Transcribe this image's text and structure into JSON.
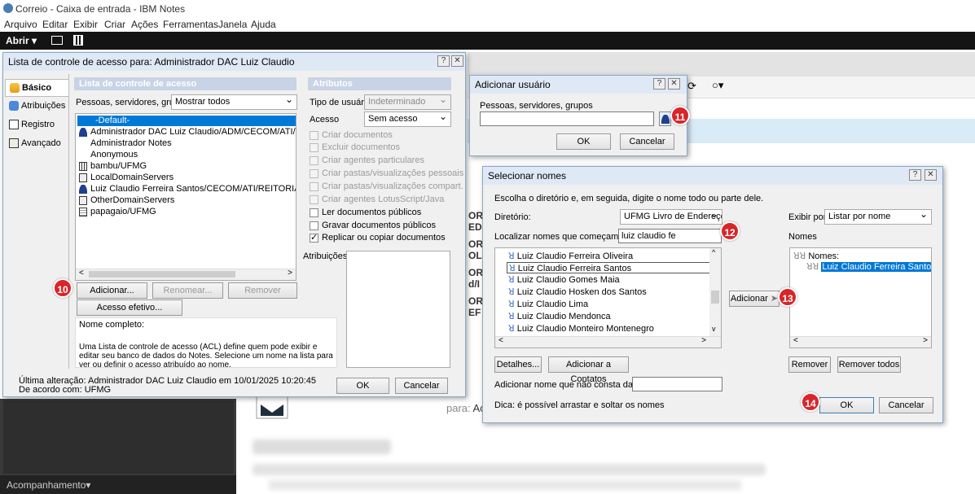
{
  "app": {
    "title": "Correio - Caixa de entrada - IBM Notes",
    "menu": [
      "Arquivo",
      "Editar",
      "Exibir",
      "Criar",
      "Ações",
      "Ferramentas",
      "Janela",
      "Ajuda"
    ],
    "toolbar_open": "Abrir ▾",
    "sidebar_footer": "Acompanhamento▾",
    "bg_letters": [
      "OR",
      "ED",
      "OR",
      "OL",
      "OR",
      "d/I",
      "OR",
      "EF"
    ],
    "to_label": "para:",
    "to_value": "Ac",
    "colors": {
      "toolbar": "#141414",
      "dialog_title": "#dfe9f5",
      "section_header": "#c9d3e6",
      "selection": "#0078d7",
      "badge": "#d9252a"
    }
  },
  "acl": {
    "title": "Lista de controle de acesso para: Administrador DAC Luiz Claudio",
    "tabs": [
      {
        "label": "Básico",
        "icon": "people-icon"
      },
      {
        "label": "Atribuições",
        "icon": "roles-icon"
      },
      {
        "label": "Registro",
        "icon": "log-icon"
      },
      {
        "label": "Avançado",
        "icon": "advanced-icon"
      }
    ],
    "list_header": "Lista de controle de acesso",
    "filter_label": "Pessoas, servidores, grupos",
    "filter_value": "Mostrar todos",
    "entries": [
      {
        "name": "-Default-",
        "icon": "none",
        "selected": true
      },
      {
        "name": "Administrador DAC Luiz Claudio/ADM/CECOM/ATI/REITOR",
        "icon": "person"
      },
      {
        "name": "Administrador Notes",
        "icon": "none"
      },
      {
        "name": "Anonymous",
        "icon": "none"
      },
      {
        "name": "bambu/UFMG",
        "icon": "server"
      },
      {
        "name": "LocalDomainServers",
        "icon": "group"
      },
      {
        "name": "Luiz Claudio Ferreira Santos/CECOM/ATI/REITORIA/UFMG",
        "icon": "person"
      },
      {
        "name": "OtherDomainServers",
        "icon": "group"
      },
      {
        "name": "papagaio/UFMG",
        "icon": "db"
      }
    ],
    "buttons": {
      "add": "Adicionar...",
      "rename": "Renomear...",
      "remove": "Remover",
      "effective": "Acesso efetivo...",
      "ok": "OK",
      "cancel": "Cancelar"
    },
    "attributes_header": "Atributos",
    "user_type_label": "Tipo de usuário",
    "user_type_value": "Indeterminado",
    "access_label": "Acesso",
    "access_value": "Sem acesso",
    "perms": [
      {
        "label": "Criar documentos",
        "checked": false,
        "enabled": false
      },
      {
        "label": "Excluir documentos",
        "checked": false,
        "enabled": false
      },
      {
        "label": "Criar agentes particulares",
        "checked": false,
        "enabled": false
      },
      {
        "label": "Criar pastas/visualizações pessoais",
        "checked": false,
        "enabled": false
      },
      {
        "label": "Criar pastas/visualizações compart.",
        "checked": false,
        "enabled": false
      },
      {
        "label": "Criar agentes LotusScript/Java",
        "checked": false,
        "enabled": false
      },
      {
        "label": "Ler documentos públicos",
        "checked": false,
        "enabled": true
      },
      {
        "label": "Gravar documentos públicos",
        "checked": false,
        "enabled": true
      },
      {
        "label": "Replicar ou copiar documentos",
        "checked": true,
        "enabled": true
      }
    ],
    "roles_label": "Atribuições",
    "full_name_label": "Nome completo:",
    "help_text": "Uma Lista de controle de acesso (ACL) define quem pode exibir e editar seu banco de dados do Notes. Selecione um nome na lista para ver ou definir o acesso atribuído ao nome.",
    "last_change": "Última alteração: Administrador DAC Luiz Claudio em 10/01/2025 10:20:45",
    "agreed": "De acordo com: UFMG"
  },
  "add_user": {
    "title": "Adicionar usuário",
    "label": "Pessoas, servidores, grupos",
    "value": "",
    "ok": "OK",
    "cancel": "Cancelar"
  },
  "select_names": {
    "title": "Selecionar nomes",
    "instruction": "Escolha o diretório e, em seguida, digite o nome todo ou parte dele.",
    "directory_label": "Diretório:",
    "directory_value": "UFMG Livro de Endereço:",
    "search_label": "Localizar nomes que começam com:",
    "search_value": "luiz claudio fe",
    "results": [
      {
        "name": "Luiz Claudio Ferreira Oliveira",
        "selected": false
      },
      {
        "name": "Luiz Claudio Ferreira Santos",
        "selected": true
      },
      {
        "name": "Luiz Claudio Gomes Maia",
        "selected": false
      },
      {
        "name": "Luiz Claudio Hosken dos Santos",
        "selected": false
      },
      {
        "name": "Luiz Claudio Lima",
        "selected": false
      },
      {
        "name": "Luiz Claudio Mendonca",
        "selected": false
      },
      {
        "name": "Luiz Claudio Monteiro Montenegro",
        "selected": false
      }
    ],
    "add_button": "Adicionar",
    "view_by_label": "Exibir por:",
    "view_by_value": "Listar por nome",
    "names_label": "Nomes",
    "names_group": "Nomes:",
    "names_selected": "Luiz Claudio Ferreira Santos/CECO",
    "details": "Detalhes...",
    "add_contacts": "Adicionar a Contatos",
    "remove": "Remover",
    "remove_all": "Remover todos",
    "unlisted_label": "Adicionar nome que não consta da lista:",
    "tip": "Dica: é possível arrastar e soltar os nomes",
    "ok": "OK",
    "cancel": "Cancelar"
  },
  "badges": [
    "10",
    "11",
    "12",
    "13",
    "14"
  ]
}
